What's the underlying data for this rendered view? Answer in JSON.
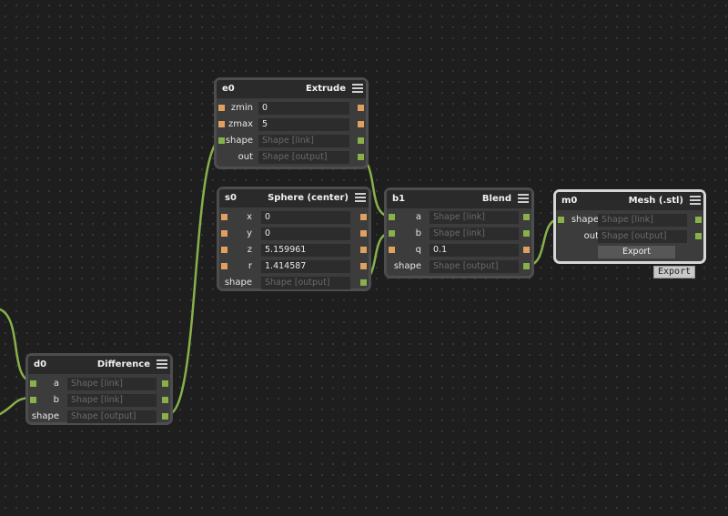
{
  "colors": {
    "background": "#1e1e1e",
    "node": "#3c3c3c",
    "wire": "#88b04b",
    "float_port": "#e0a060",
    "shape_port": "#88b04b"
  },
  "nodes": {
    "e0": {
      "id": "e0",
      "title": "Extrude",
      "rows": [
        {
          "label": "zmin",
          "value": "0"
        },
        {
          "label": "zmax",
          "value": "5"
        },
        {
          "label": "shape",
          "value": "Shape [link]"
        },
        {
          "label": "out",
          "value": "Shape [output]"
        }
      ]
    },
    "s0": {
      "id": "s0",
      "title": "Sphere (center)",
      "rows": [
        {
          "label": "x",
          "value": "0"
        },
        {
          "label": "y",
          "value": "0"
        },
        {
          "label": "z",
          "value": "5.159961"
        },
        {
          "label": "r",
          "value": "1.414587"
        },
        {
          "label": "shape",
          "value": "Shape [output]"
        }
      ]
    },
    "b1": {
      "id": "b1",
      "title": "Blend",
      "rows": [
        {
          "label": "a",
          "value": "Shape [link]"
        },
        {
          "label": "b",
          "value": "Shape [link]"
        },
        {
          "label": "q",
          "value": "0.1"
        },
        {
          "label": "shape",
          "value": "Shape [output]"
        }
      ]
    },
    "m0": {
      "id": "m0",
      "title": "Mesh (.stl)",
      "rows": [
        {
          "label": "shape",
          "value": "Shape [link]"
        },
        {
          "label": "out",
          "value": "Shape [output]"
        }
      ],
      "button": "Export"
    },
    "d0": {
      "id": "d0",
      "title": "Difference",
      "rows": [
        {
          "label": "a",
          "value": "Shape [link]"
        },
        {
          "label": "b",
          "value": "Shape [link]"
        },
        {
          "label": "shape",
          "value": "Shape [output]"
        }
      ]
    }
  },
  "tooltip": "Export"
}
